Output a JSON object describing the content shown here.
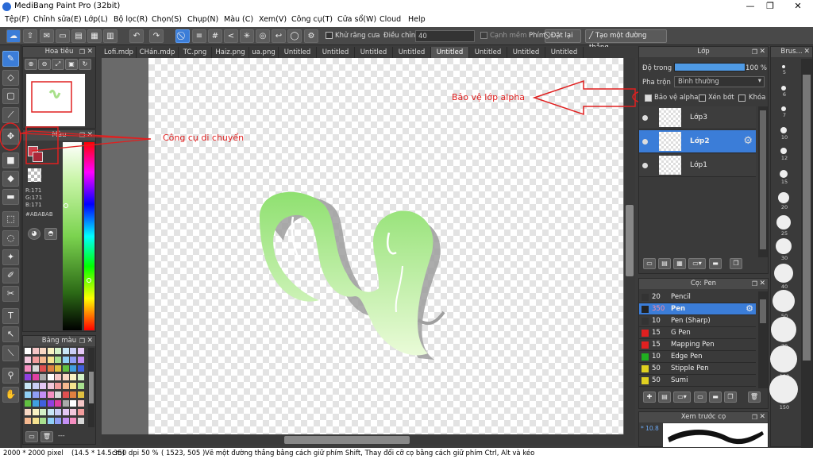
{
  "window": {
    "title": "MediBang Paint Pro (32bit)"
  },
  "menu": [
    "Tệp(F)",
    "Chỉnh sửa(E)",
    "Lớp(L)",
    "Bộ lọc(R)",
    "Chọn(S)",
    "Chụp(N)",
    "Màu (C)",
    "Xem(V)",
    "Công cụ(T)",
    "Cửa sổ(W)",
    "Cloud",
    "Help"
  ],
  "toolbar": {
    "antialias_label": "Khử răng cưa",
    "adjust_label": "Điều chỉnh",
    "adjust_value": "40",
    "smooth_label": "Cạnh mềm",
    "key_label": "Phím",
    "reset_label": "Đặt lại",
    "straight_line_label": "Tạo một đường thẳng"
  },
  "navigator": {
    "title": "Hoa tiêu"
  },
  "color_panel": {
    "title": "Màu",
    "r": "R:171",
    "g": "G:171",
    "b": "B:171",
    "hex": "#ABABAB"
  },
  "palette": {
    "title": "Bảng màu",
    "footer": "---"
  },
  "tabs": [
    "Lofi.mdp",
    "CHán.mdp",
    "TC.png",
    "Haiz.png",
    "ua.png",
    "Untitled",
    "Untitled",
    "Untitled",
    "Untitled",
    "Untitled",
    "Untitled",
    "Untitled",
    "Untitled"
  ],
  "selected_tab_index": 9,
  "layer_panel": {
    "title": "Lớp",
    "opacity_label": "Độ trong",
    "opacity_value": "100 %",
    "blend_label": "Pha trộn",
    "blend_value": "Bình thường",
    "protect_alpha": "Bảo vệ alpha",
    "clip": "Xén bớt",
    "lock": "Khóa",
    "layers": [
      {
        "name": "Lớp3",
        "selected": false
      },
      {
        "name": "Lớp2",
        "selected": true
      },
      {
        "name": "Lớp1",
        "selected": false
      }
    ]
  },
  "brush_panel": {
    "title": "Cọ: Pen",
    "brushes": [
      {
        "size": "20",
        "name": "Pencil",
        "color": "#333333",
        "selected": false
      },
      {
        "size": "350",
        "name": "Pen",
        "color": "#222222",
        "selected": true
      },
      {
        "size": "10",
        "name": "Pen (Sharp)",
        "color": "#333333",
        "selected": false
      },
      {
        "size": "15",
        "name": "G Pen",
        "color": "#e02020",
        "selected": false
      },
      {
        "size": "15",
        "name": "Mapping Pen",
        "color": "#e02020",
        "selected": false
      },
      {
        "size": "10",
        "name": "Edge Pen",
        "color": "#20b020",
        "selected": false
      },
      {
        "size": "50",
        "name": "Stipple Pen",
        "color": "#e0d020",
        "selected": false
      },
      {
        "size": "50",
        "name": "Sumi",
        "color": "#e0d020",
        "selected": false
      }
    ]
  },
  "brush_preview": {
    "title": "Xem trước cọ",
    "value": "* 10.8"
  },
  "brush_sizes_panel": {
    "title": "Brus...",
    "sizes": [
      "5",
      "6",
      "7",
      "10",
      "12",
      "15",
      "20",
      "25",
      "30",
      "40",
      "50",
      "70",
      "100",
      "150"
    ]
  },
  "annotations": {
    "alpha": "Bảo vệ lớp alpha",
    "move": "Công cụ di chuyển"
  },
  "colors": {
    "accent": "#3b7dd8",
    "annotation": "#e02020"
  },
  "status": {
    "size": "2000 * 2000 pixel",
    "cm": "(14.5 * 14.5cm)",
    "dpi": "350 dpi",
    "zoom": "50 %",
    "coords": "( 1523, 505 )",
    "hint": "Vẽ một đường thẳng bằng cách giữ phím Shift, Thay đổi cỡ cọ bằng cách giữ phím Ctrl, Alt và kéo"
  }
}
